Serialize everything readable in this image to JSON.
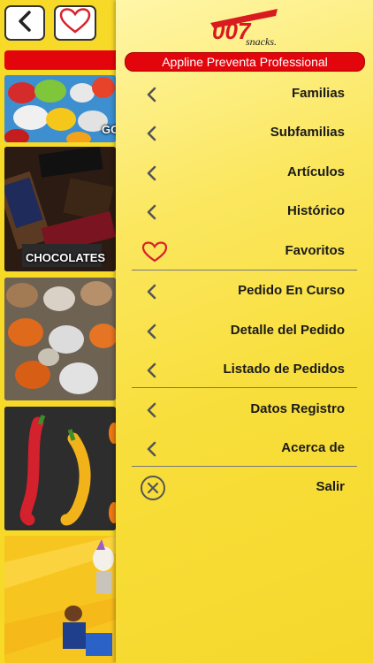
{
  "background": {
    "tiles": [
      {
        "label": "GO"
      },
      {
        "label": "CHOCOLATES"
      }
    ]
  },
  "drawer": {
    "logo": {
      "brand": "007",
      "sub": "snacks."
    },
    "app_title": "Appline Preventa Professional",
    "menu": [
      {
        "label": "Familias",
        "icon": "chevron-left-icon"
      },
      {
        "label": "Subfamilias",
        "icon": "chevron-left-icon"
      },
      {
        "label": "Artículos",
        "icon": "chevron-left-icon"
      },
      {
        "label": "Histórico",
        "icon": "chevron-left-icon"
      },
      {
        "label": "Favoritos",
        "icon": "heart-icon"
      },
      {
        "label": "Pedido En Curso",
        "icon": "chevron-left-icon"
      },
      {
        "label": "Detalle del Pedido",
        "icon": "chevron-left-icon"
      },
      {
        "label": "Listado de Pedidos",
        "icon": "chevron-left-icon"
      },
      {
        "label": "Datos Registro",
        "icon": "chevron-left-icon"
      },
      {
        "label": "Acerca de",
        "icon": "chevron-left-icon"
      },
      {
        "label": "Salir",
        "icon": "close-circle-icon"
      }
    ]
  },
  "colors": {
    "accent_red": "#e3050c",
    "drawer_yellow": "#f8de3a"
  }
}
